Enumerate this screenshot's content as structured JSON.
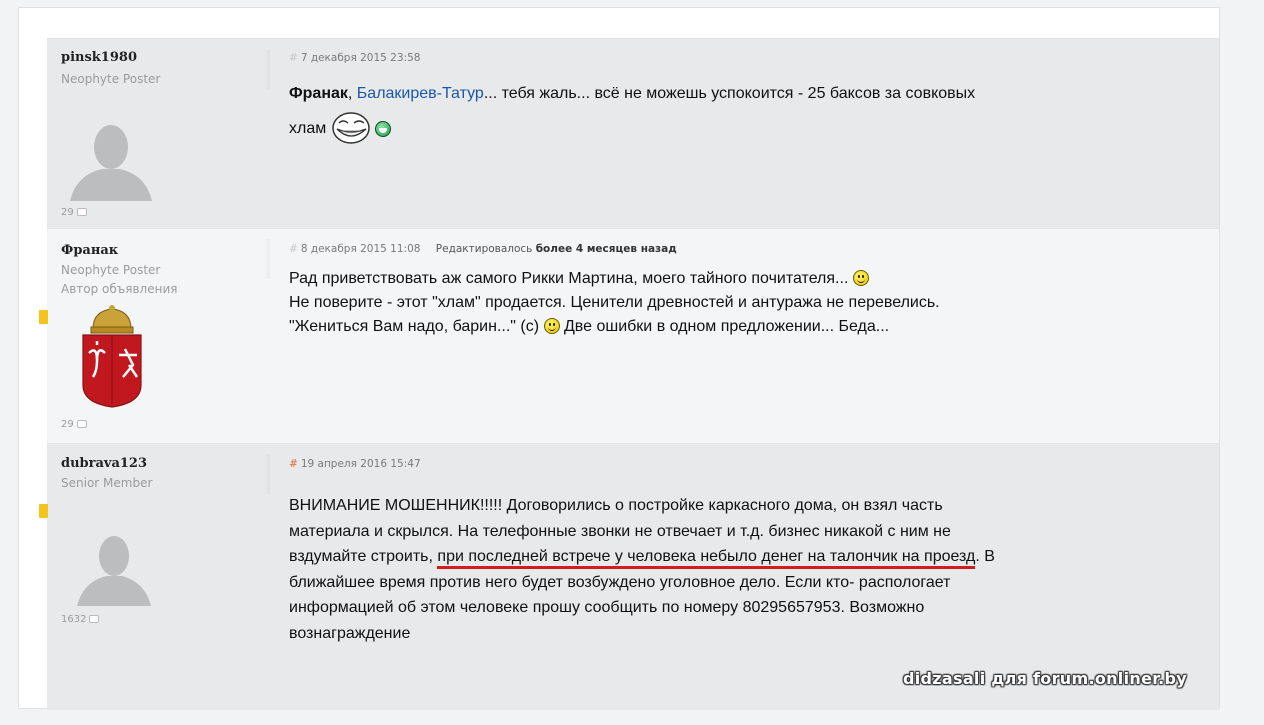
{
  "posts": [
    {
      "username": "pinsk1980",
      "rank": "Neophyte Poster",
      "post_count": "29",
      "date": "7 декабря 2015 23:58",
      "message": {
        "mention1": "Франак",
        "sep": ", ",
        "mention2": "Балакирев-Татур",
        "text1": "... тебя жаль... всё не можешь успокоится - 25 баксов за совковых",
        "text2": "хлам"
      }
    },
    {
      "username": "Франак",
      "rank": "Neophyte Poster",
      "role": "Автор объявления",
      "post_count": "29",
      "date": "8 декабря 2015 11:08",
      "edited_label": "Редактировалось",
      "edited_value": "более 4 месяцев назад",
      "lines": [
        "Рад приветствовать аж самого Рикки Мартина, моего тайного почитателя...",
        "Не поверите - этот \"хлам\" продается. Ценители древностей и антуража не перевелись.",
        "\"Жениться Вам надо, барин...\" (с)",
        "Две ошибки в одном предложении... Беда..."
      ]
    },
    {
      "username": "dubrava123",
      "rank": "Senior Member",
      "post_count": "1632",
      "date": "19 апреля 2016 15:47",
      "lines": [
        "ВНИМАНИЕ МОШЕННИК!!!!! Договорились о постройке каркасного дома, он взял часть",
        "материала и скрылся. На телефонные звонки не отвечает и т.д. бизнес никакой с ним не",
        "вздумайте строить, ",
        "при последней встрече у человека небыло денег на талончик на проезд",
        ". В",
        "ближайшее время против него будет возбуждено уголовное дело. Если кто- распологает",
        "информацией об этом человеке прошу сообщить по номеру 80295657953. Возможно",
        "вознаграждение"
      ]
    }
  ],
  "watermark": "didzasali для forum.onliner.by",
  "colors": {
    "link": "#1a57a8",
    "underline": "#d41c1c",
    "marker": "#f6c21e"
  }
}
